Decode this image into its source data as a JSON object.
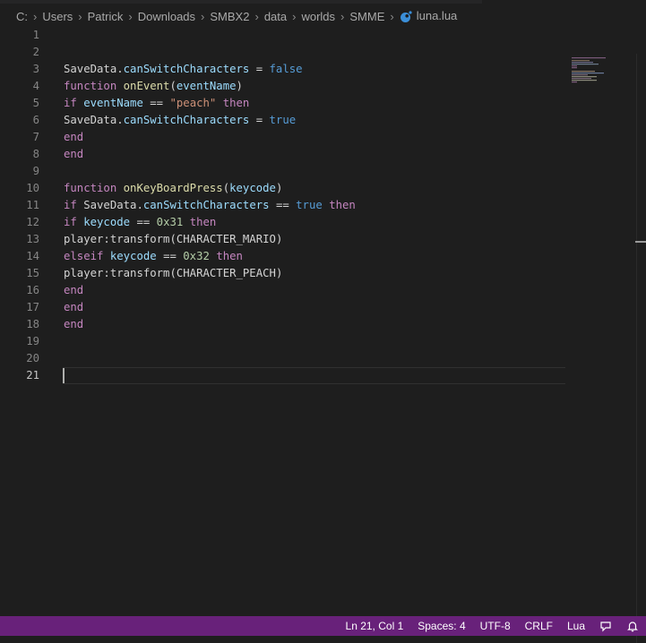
{
  "breadcrumb": {
    "items": [
      "C:",
      "Users",
      "Patrick",
      "Downloads",
      "SMBX2",
      "data",
      "worlds",
      "SMME"
    ],
    "file": "luna.lua",
    "file_icon": "lua-file-icon"
  },
  "editor": {
    "line_numbers": [
      "1",
      "2",
      "3",
      "4",
      "5",
      "6",
      "7",
      "8",
      "9",
      "10",
      "11",
      "12",
      "13",
      "14",
      "15",
      "16",
      "17",
      "18",
      "19",
      "20",
      "21"
    ],
    "active_line": 21,
    "code_lines": [
      "",
      "",
      "SaveData.canSwitchCharacters = false",
      "function onEvent(eventName)",
      "if eventName == \"peach\" then",
      "SaveData.canSwitchCharacters = true",
      "end",
      "end",
      "",
      "function onKeyBoardPress(keycode)",
      "if SaveData.canSwitchCharacters == true then",
      "if keycode == 0x31 then",
      "player:transform(CHARACTER_MARIO)",
      "elseif keycode == 0x32 then",
      "player:transform(CHARACTER_PEACH)",
      "end",
      "end",
      "end",
      "",
      "",
      ""
    ]
  },
  "statusbar": {
    "position": "Ln 21, Col 1",
    "indent": "Spaces: 4",
    "encoding": "UTF-8",
    "eol": "CRLF",
    "language": "Lua",
    "feedback_icon": "feedback-icon",
    "bell_icon": "bell-icon"
  },
  "colors": {
    "background": "#1e1e1e",
    "statusbar": "#68217a",
    "keyword": "#c586c0",
    "constant": "#569cd6",
    "function": "#dcdcaa",
    "property": "#9cdcfe",
    "string": "#ce9178",
    "number": "#b5cea8"
  }
}
